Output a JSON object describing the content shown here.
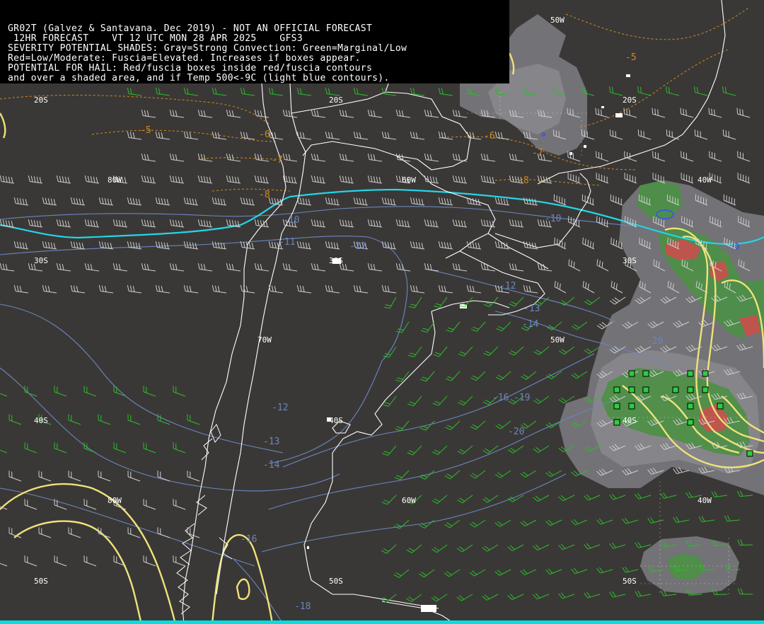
{
  "header": {
    "lines": [
      "GR02T (Galvez & Santavana. Dec 2019) - NOT AN OFFICIAL FORECAST",
      " 12HR FORECAST    VT 12 UTC MON 28 APR 2025    GFS3",
      "SEVERITY POTENTIAL SHADES: Gray=Strong Convection: Green=Marginal/Low",
      "Red=Low/Moderate: Fuscia=Elevated. Increases if boxes appear.",
      "POTENTIAL FOR HAIL: Red/fuscia boxes inside red/fuscia contours",
      "and over a shaded area, and if Temp 500<-9C (light blue contours)."
    ]
  },
  "grid_labels": {
    "lat_20s": "20S",
    "lat_30s": "30S",
    "lat_40s": "40S",
    "lat_50s": "50S",
    "lon_80w": "80W",
    "lon_70w": "70W",
    "lon_60w": "60W",
    "lon_50w": "50W",
    "lon_40w": "40W"
  },
  "temperature_labels": {
    "orange": [
      "-5",
      "-5",
      "-6",
      "-6",
      "-7",
      "-7",
      "-8",
      "-8"
    ],
    "blue": [
      "-10",
      "-10",
      "-11",
      "-12",
      "-12",
      "-13",
      "-14",
      "-20",
      "-12",
      "-13",
      "-14",
      "-16",
      "-18",
      "-16",
      "-19",
      "-20"
    ]
  },
  "colors": {
    "background": "#3a3836",
    "coast": "#ffffff",
    "jet_axis": "#22d6e6",
    "orange_contour": "#d08a1e",
    "blue_contour": "#6a86c0",
    "severity_contour": "#f0e27a",
    "gray_shade": "#7c7b80",
    "green_shade": "#4e8f48",
    "red_shade": "#c4534e",
    "hail_box": "#2ecc40",
    "wind_barb_strong": "#cfcfcf",
    "wind_barb_weak": "#2bbd2b"
  }
}
